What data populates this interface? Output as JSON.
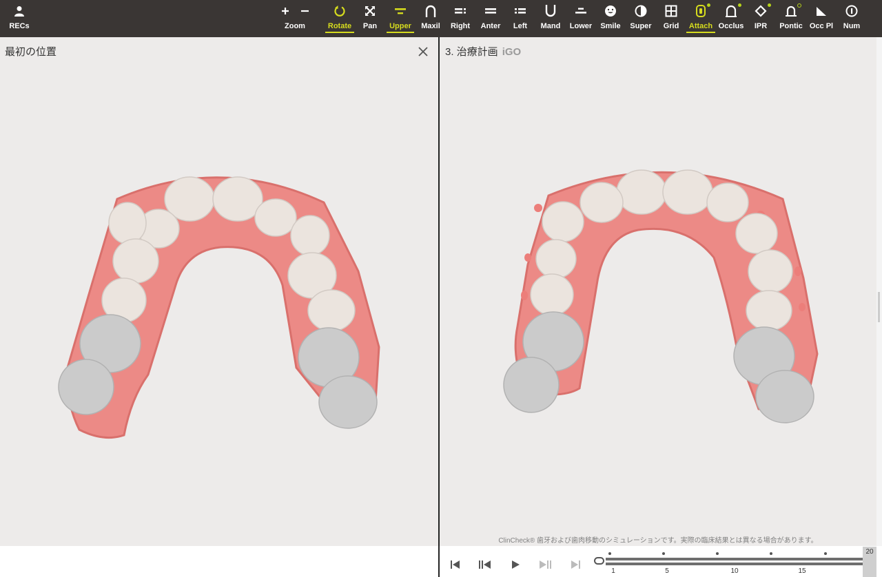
{
  "toolbar": {
    "recs": "RECs",
    "buttons": [
      {
        "label": "Zoom"
      },
      {
        "label": "Rotate"
      },
      {
        "label": "Pan"
      },
      {
        "label": "Upper"
      },
      {
        "label": "Maxil"
      },
      {
        "label": "Right"
      },
      {
        "label": "Anter"
      },
      {
        "label": "Left"
      },
      {
        "label": "Mand"
      },
      {
        "label": "Lower"
      },
      {
        "label": "Smile"
      },
      {
        "label": "Super"
      },
      {
        "label": "Grid"
      },
      {
        "label": "Attach"
      },
      {
        "label": "Occlus"
      },
      {
        "label": "IPR"
      },
      {
        "label": "Pontic"
      },
      {
        "label": "Occ Pl"
      },
      {
        "label": "Num"
      }
    ],
    "active": [
      "Rotate",
      "Upper",
      "Attach"
    ],
    "colors": {
      "bar": "#3a3634",
      "active": "#d6dc1e",
      "indicator": "#b7d31a"
    }
  },
  "left_panel": {
    "title": "最初の位置"
  },
  "right_panel": {
    "title": "3. 治療計画",
    "subtitle": "iGO"
  },
  "disclaimer": "ClinCheck® 歯牙および歯肉移動のシミュレーションです。実際の臨床結果とは異なる場合があります。",
  "timeline": {
    "ticks": [
      "1",
      "5",
      "10",
      "15"
    ],
    "end_value": "20",
    "current": "1"
  },
  "colors": {
    "gum": "#ec8a86",
    "tooth": "#ebe4de",
    "molar": "#c9c9c9",
    "background": "#edebea"
  }
}
